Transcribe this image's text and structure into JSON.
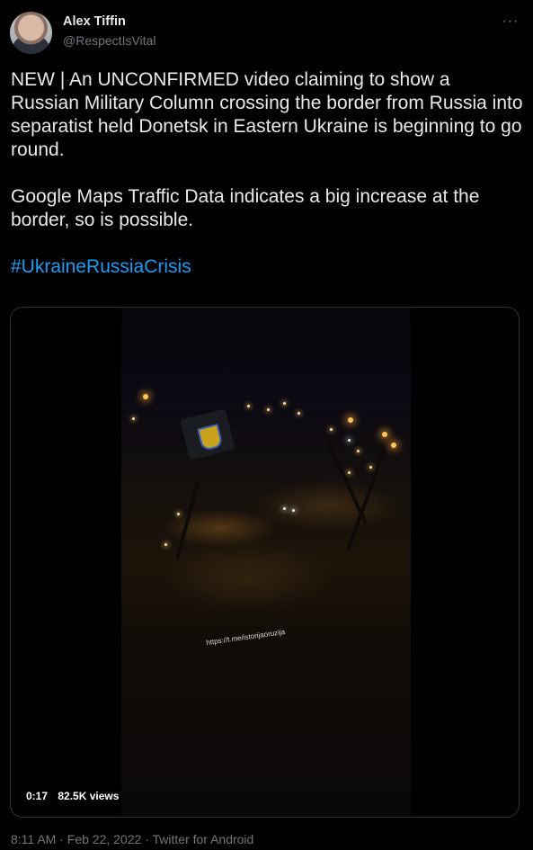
{
  "author": {
    "display_name": "Alex Tiffin",
    "handle": "@RespectIsVital"
  },
  "more_icon": "more-horizontal-icon",
  "tweet": {
    "paragraph_1": "NEW | An UNCONFIRMED video claiming to show a Russian Military Column crossing the border from Russia into separatist held Donetsk in Eastern Ukraine is beginning to go round.",
    "paragraph_2": "Google Maps Traffic Data indicates a big increase at the border, so is possible.",
    "hashtag": "#UkraineRussiaCrisis"
  },
  "video": {
    "duration": "0:17",
    "views": "82.5K views",
    "watermark": "https://t.me/istorijaoruzija"
  },
  "footer": {
    "time": "8:11 AM",
    "date": "Feb 22, 2022",
    "source": "Twitter for Android",
    "separator": "·"
  },
  "colors": {
    "background": "#000000",
    "text": "#e7e9ea",
    "muted": "#71767b",
    "link": "#1d9bf0"
  }
}
